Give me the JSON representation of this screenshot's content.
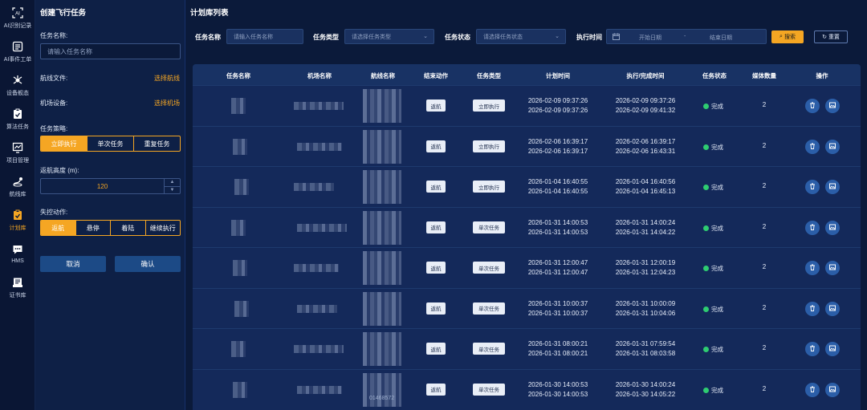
{
  "nav": [
    {
      "label": "AI识别记录",
      "icon": "ai-scan-icon"
    },
    {
      "label": "AI事件工单",
      "icon": "event-ticket-icon"
    },
    {
      "label": "设备舰态",
      "icon": "device-icon"
    },
    {
      "label": "算法任务",
      "icon": "algorithm-task-icon"
    },
    {
      "label": "项目管理",
      "icon": "project-icon"
    },
    {
      "label": "航线库",
      "icon": "route-library-icon"
    },
    {
      "label": "计划库",
      "icon": "plan-library-icon"
    },
    {
      "label": "HMS",
      "icon": "hms-chat-icon"
    },
    {
      "label": "证书库",
      "icon": "certificate-icon"
    }
  ],
  "create": {
    "title": "创建飞行任务",
    "name_label": "任务名称:",
    "name_placeholder": "请输入任务名称",
    "route_label": "航线文件:",
    "route_link": "选择航线",
    "dock_label": "机场设备:",
    "dock_link": "选择机场",
    "strategy_label": "任务策略:",
    "strategy_options": [
      "立即执行",
      "单次任务",
      "重复任务"
    ],
    "return_height_label": "返航高度 (m):",
    "return_height_value": "120",
    "lost_label": "失控动作:",
    "lost_options": [
      "返航",
      "悬停",
      "着陆",
      "继续执行"
    ],
    "cancel": "取消",
    "confirm": "确认"
  },
  "main": {
    "title": "计划库列表",
    "filters": {
      "name_label": "任务名称",
      "name_placeholder": "请输入任务名称",
      "type_label": "任务类型",
      "type_placeholder": "请选择任务类型",
      "status_label": "任务状态",
      "status_placeholder": "请选择任务状态",
      "time_label": "执行时间",
      "start_placeholder": "开始日期",
      "range_sep": "-",
      "end_placeholder": "结束日期",
      "search": "搜索",
      "reset": "重置"
    },
    "columns": [
      "任务名称",
      "机场名称",
      "航线名称",
      "结束动作",
      "任务类型",
      "计划时间",
      "执行/完成时间",
      "任务状态",
      "媒体数量",
      "操作"
    ],
    "rows": [
      {
        "end_action": "返航",
        "type": "立即执行",
        "plan": [
          "2026-02-09 09:37:26",
          "2026-02-09 09:37:26"
        ],
        "exec": [
          "2026-02-09 09:37:26",
          "2026-02-09 09:41:32"
        ],
        "status": "完成",
        "media": "2"
      },
      {
        "end_action": "返航",
        "type": "立即执行",
        "plan": [
          "2026-02-06 16:39:17",
          "2026-02-06 16:39:17"
        ],
        "exec": [
          "2026-02-06 16:39:17",
          "2026-02-06 16:43:31"
        ],
        "status": "完成",
        "media": "2"
      },
      {
        "end_action": "返航",
        "type": "立即执行",
        "plan": [
          "2026-01-04 16:40:55",
          "2026-01-04 16:40:55"
        ],
        "exec": [
          "2026-01-04 16:40:56",
          "2026-01-04 16:45:13"
        ],
        "status": "完成",
        "media": "2"
      },
      {
        "end_action": "返航",
        "type": "单次任务",
        "plan": [
          "2026-01-31 14:00:53",
          "2026-01-31 14:00:53"
        ],
        "exec": [
          "2026-01-31 14:00:24",
          "2026-01-31 14:04:22"
        ],
        "status": "完成",
        "media": "2"
      },
      {
        "end_action": "返航",
        "type": "单次任务",
        "plan": [
          "2026-01-31 12:00:47",
          "2026-01-31 12:00:47"
        ],
        "exec": [
          "2026-01-31 12:00:19",
          "2026-01-31 12:04:23"
        ],
        "status": "完成",
        "media": "2"
      },
      {
        "end_action": "返航",
        "type": "单次任务",
        "plan": [
          "2026-01-31 10:00:37",
          "2026-01-31 10:00:37"
        ],
        "exec": [
          "2026-01-31 10:00:09",
          "2026-01-31 10:04:06"
        ],
        "status": "完成",
        "media": "2"
      },
      {
        "end_action": "返航",
        "type": "单次任务",
        "plan": [
          "2026-01-31 08:00:21",
          "2026-01-31 08:00:21"
        ],
        "exec": [
          "2026-01-31 07:59:54",
          "2026-01-31 08:03:58"
        ],
        "status": "完成",
        "media": "2"
      },
      {
        "end_action": "返航",
        "type": "单次任务",
        "plan": [
          "2026-01-30 14:00:53",
          "2026-01-30 14:00:53"
        ],
        "exec": [
          "2026-01-30 14:00:24",
          "2026-01-30 14:05:22"
        ],
        "status": "完成",
        "media": "2"
      }
    ],
    "partial_text": "01468572"
  },
  "colors": {
    "accent": "#f5a623",
    "bg": "#0b1a3a",
    "success": "#2ecc71"
  }
}
